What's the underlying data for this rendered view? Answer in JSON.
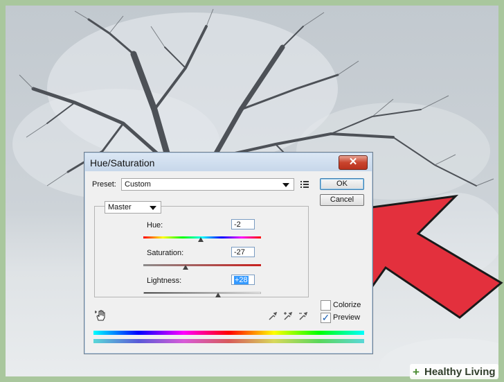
{
  "dialog": {
    "title": "Hue/Saturation",
    "preset_label": "Preset:",
    "preset_value": "Custom",
    "ok_label": "OK",
    "cancel_label": "Cancel",
    "channel_value": "Master",
    "hue_label": "Hue:",
    "hue_value": "-2",
    "saturation_label": "Saturation:",
    "saturation_value": "-27",
    "lightness_label": "Lightness:",
    "lightness_value": "+28",
    "colorize_label": "Colorize",
    "preview_label": "Preview",
    "colorize_checked": false,
    "preview_checked": true
  },
  "watermark": {
    "brand_plus": "+",
    "brand_text": "Healthy Living"
  },
  "icons": {
    "close": "close-icon",
    "preset_menu": "preset-options-icon",
    "targeted_adjustment": "hand-adjust-icon",
    "eyedroppers": [
      "eyedropper-icon",
      "eyedropper-plus-icon",
      "eyedropper-minus-icon"
    ]
  },
  "colors": {
    "arrow_red": "#e3303d",
    "close_red": "#c9442d",
    "accent_blue": "#3399ff"
  }
}
